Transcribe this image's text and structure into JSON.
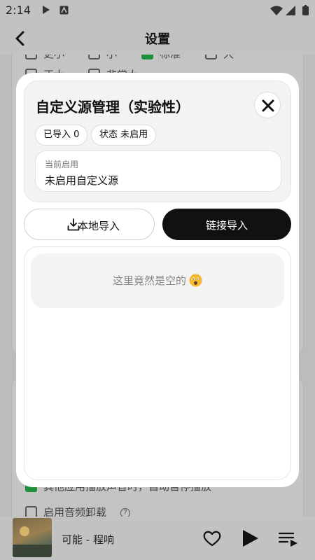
{
  "status_bar": {
    "time": "2:14"
  },
  "app_bar": {
    "title": "设置"
  },
  "background": {
    "option_labels_row1": [
      "更小",
      "小",
      "标准",
      "大"
    ],
    "option_labels_row2": [
      "正大",
      "非常大"
    ],
    "settings": [
      {
        "label": "其他应用播放声音时，自动暂停播放",
        "checked": true
      },
      {
        "label": "启用音频卸载",
        "checked": false
      }
    ]
  },
  "player": {
    "song": "可能 - 程响"
  },
  "modal": {
    "title": "自定义源管理（实验性）",
    "imported_pill": "已导入 0",
    "status_pill": "状态 未启用",
    "current_label": "当前启用",
    "current_value": "未启用自定义源",
    "local_import_label": "本地导入",
    "link_import_label": "链接导入",
    "empty_text": "这里竟然是空的"
  },
  "colors": {
    "accent_green": "#1e8f3a",
    "primary_button": "#111111"
  }
}
